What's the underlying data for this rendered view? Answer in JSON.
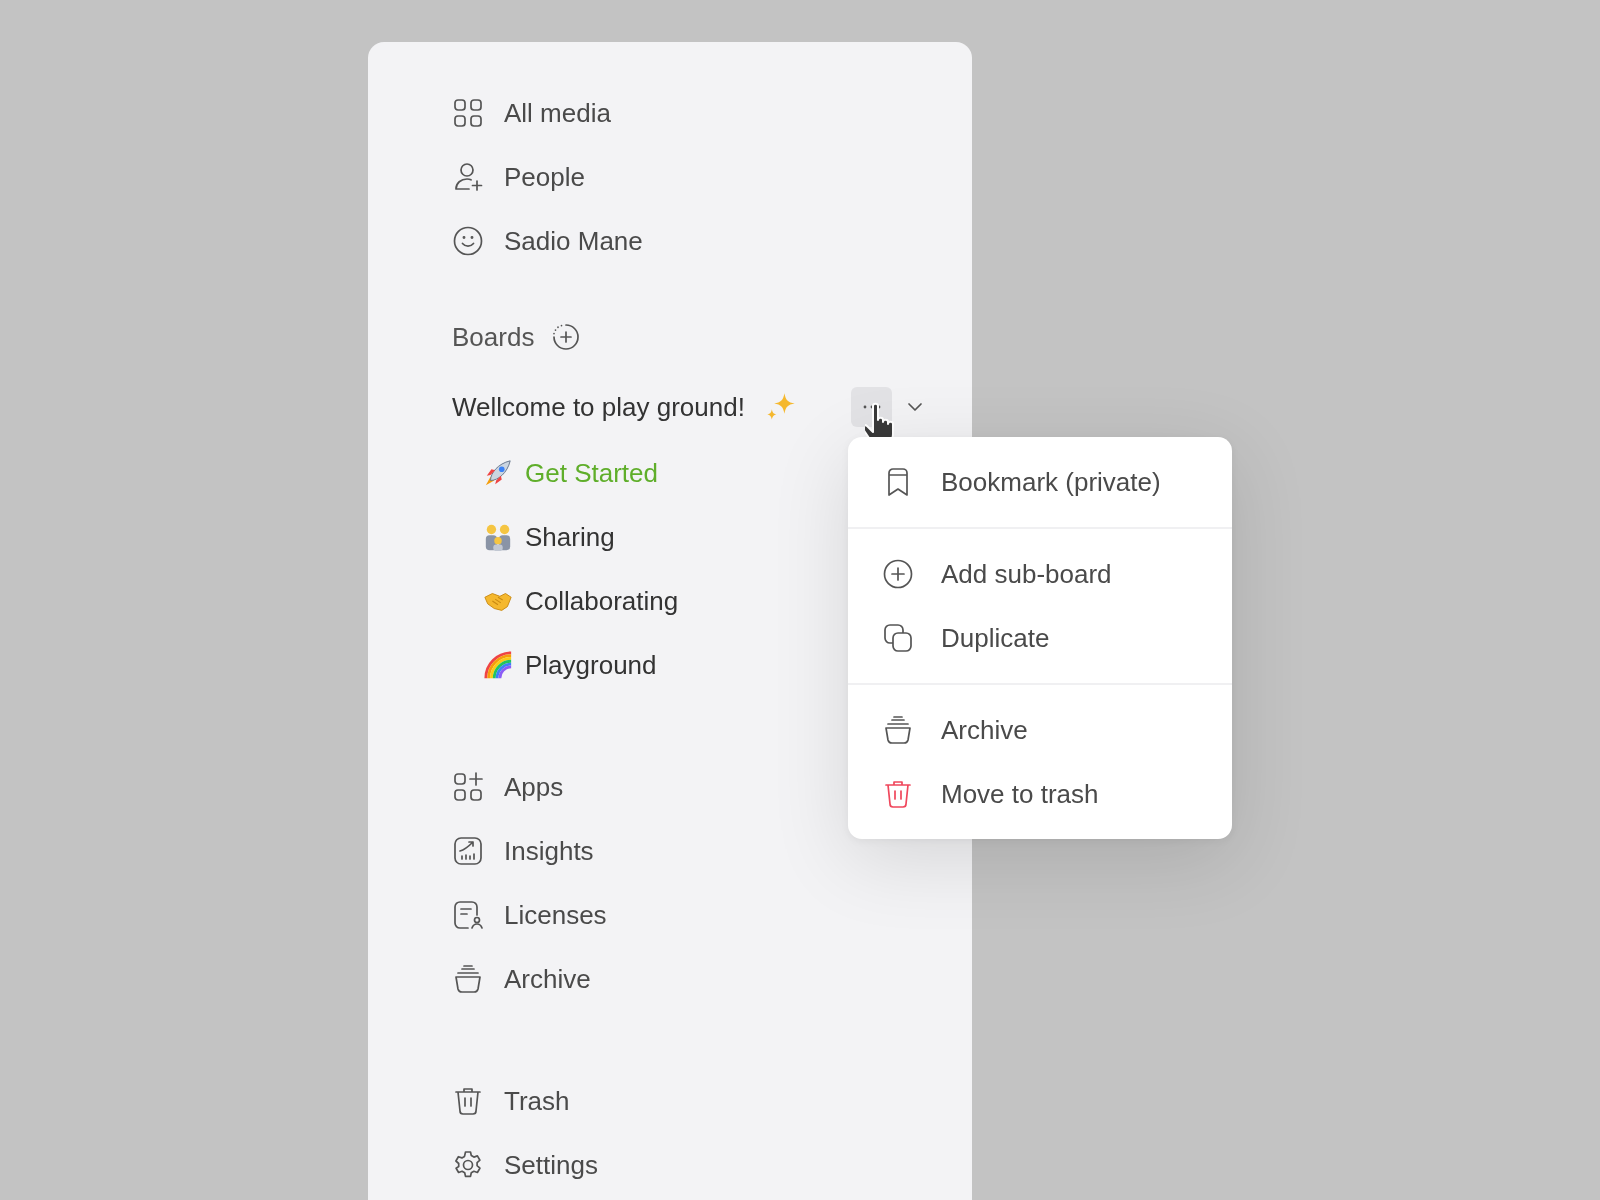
{
  "nav": [
    {
      "label": "All media"
    },
    {
      "label": "People"
    },
    {
      "label": "Sadio Mane"
    }
  ],
  "boards": {
    "title": "Boards",
    "workspace": {
      "title": "Wellcome to play ground!",
      "hovered": true
    },
    "items": [
      {
        "label": "Get Started",
        "selected": true
      },
      {
        "label": "Sharing",
        "selected": false
      },
      {
        "label": "Collaborating",
        "selected": false
      },
      {
        "label": "Playground",
        "selected": false
      }
    ]
  },
  "tools": [
    {
      "label": "Apps"
    },
    {
      "label": "Insights"
    },
    {
      "label": "Licenses"
    },
    {
      "label": "Archive"
    }
  ],
  "footer": [
    {
      "label": "Trash"
    },
    {
      "label": "Settings"
    }
  ],
  "menu": {
    "groups": [
      [
        {
          "label": "Bookmark (private)",
          "kind": "normal"
        }
      ],
      [
        {
          "label": "Add sub-board",
          "kind": "normal"
        },
        {
          "label": "Duplicate",
          "kind": "normal"
        }
      ],
      [
        {
          "label": "Archive",
          "kind": "normal"
        },
        {
          "label": "Move to trash",
          "kind": "danger"
        }
      ]
    ]
  }
}
